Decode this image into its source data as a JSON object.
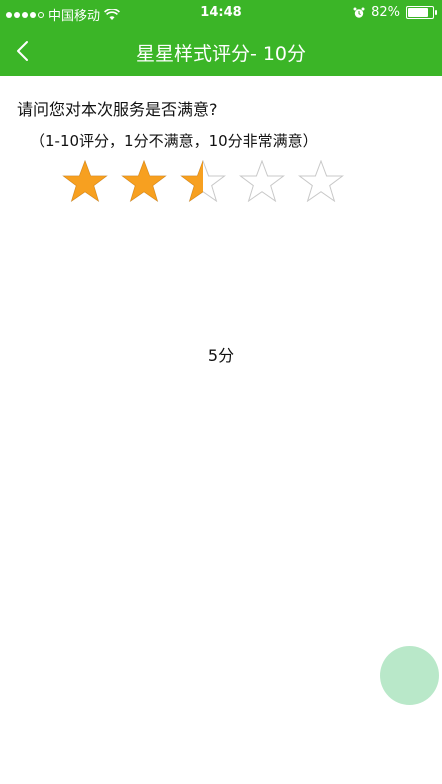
{
  "status_bar": {
    "carrier": "中国移动",
    "time": "14:48",
    "battery": "82%",
    "battery_level": 0.82
  },
  "nav": {
    "title": "星星样式评分- 10分",
    "back_icon": "chevron-left-icon"
  },
  "rating": {
    "question": "请问您对本次服务是否满意?",
    "hint": "（1-10评分，1分不满意，10分非常满意）",
    "max": 10,
    "value": 5,
    "star_count": 5,
    "score_label": "5分",
    "colors": {
      "filled": "#f7a020",
      "outline": "#c8c8c8"
    }
  },
  "colors": {
    "primary": "#3bb527",
    "fab": "#b9e8c9"
  }
}
